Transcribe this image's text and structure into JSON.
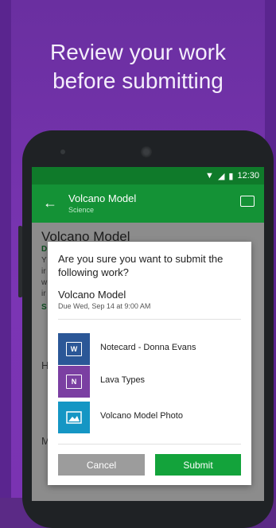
{
  "headline": {
    "line1": "Review your work",
    "line2": "before submitting"
  },
  "status": {
    "time": "12:30"
  },
  "appbar": {
    "title": "Volcano Model",
    "subtitle": "Science"
  },
  "background": {
    "title": "Volcano Model",
    "due_initial": "D",
    "lines": [
      "Y",
      "ir",
      "w",
      "ir"
    ],
    "section_initial": "S",
    "h_initial": "H",
    "m_initial": "M"
  },
  "dialog": {
    "question": "Are you sure you want to submit the following work?",
    "item_title": "Volcano Model",
    "due": "Due Wed, Sep 14 at 9:00 AM",
    "files": [
      {
        "name": "Notecard - Donna Evans",
        "icon": "word-icon",
        "badge": "W"
      },
      {
        "name": "Lava Types",
        "icon": "onenote-icon",
        "badge": "N"
      },
      {
        "name": "Volcano Model Photo",
        "icon": "photo-icon",
        "badge": ""
      }
    ],
    "cancel_label": "Cancel",
    "submit_label": "Submit"
  },
  "colors": {
    "purple": "#7b35b4",
    "green": "#149236",
    "submit": "#13a33b",
    "word": "#2b5797",
    "onenote": "#7b3fa2",
    "photo": "#1596c4"
  }
}
